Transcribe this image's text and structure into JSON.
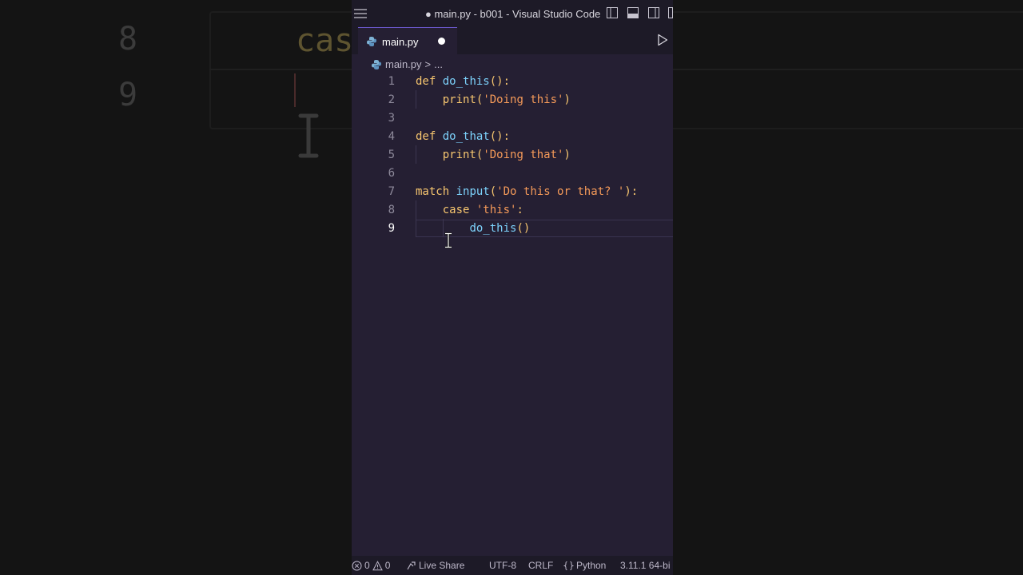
{
  "background": {
    "line_numbers": [
      "8",
      "9"
    ],
    "keyword_fragment": "cas"
  },
  "window": {
    "title": "● main.py - b001 - Visual Studio Code"
  },
  "tab": {
    "label": "main.py"
  },
  "breadcrumb": {
    "file": "main.py",
    "separator": ">",
    "more": "..."
  },
  "code": {
    "line_numbers": [
      "1",
      "2",
      "3",
      "4",
      "5",
      "6",
      "7",
      "8",
      "9"
    ],
    "current_line": 9,
    "tokens": {
      "l1_def": "def",
      "l1_name": "do_this",
      "l1_paren": "():",
      "l2_fn": "print",
      "l2_open": "(",
      "l2_str": "'Doing this'",
      "l2_close": ")",
      "l4_def": "def",
      "l4_name": "do_that",
      "l4_paren": "():",
      "l5_fn": "print",
      "l5_open": "(",
      "l5_str": "'Doing that'",
      "l5_close": ")",
      "l7_kw": "match",
      "l7_fn": "input",
      "l7_open": "(",
      "l7_str": "'Do this or that? '",
      "l7_close": "):",
      "l8_kw": "case",
      "l8_str": "'this'",
      "l8_colon": ":",
      "l9_fn": "do_this",
      "l9_paren": "()"
    }
  },
  "statusbar": {
    "errors": "0",
    "warnings": "0",
    "live_share": "Live Share",
    "encoding": "UTF-8",
    "eol": "CRLF",
    "language": "Python",
    "interpreter": "3.11.1 64-bi"
  },
  "colors": {
    "editor_bg": "#251f33",
    "chrome_bg": "#1d1a27",
    "keyword": "#f7c66f",
    "function": "#7dd3fc",
    "string": "#f59a59"
  }
}
